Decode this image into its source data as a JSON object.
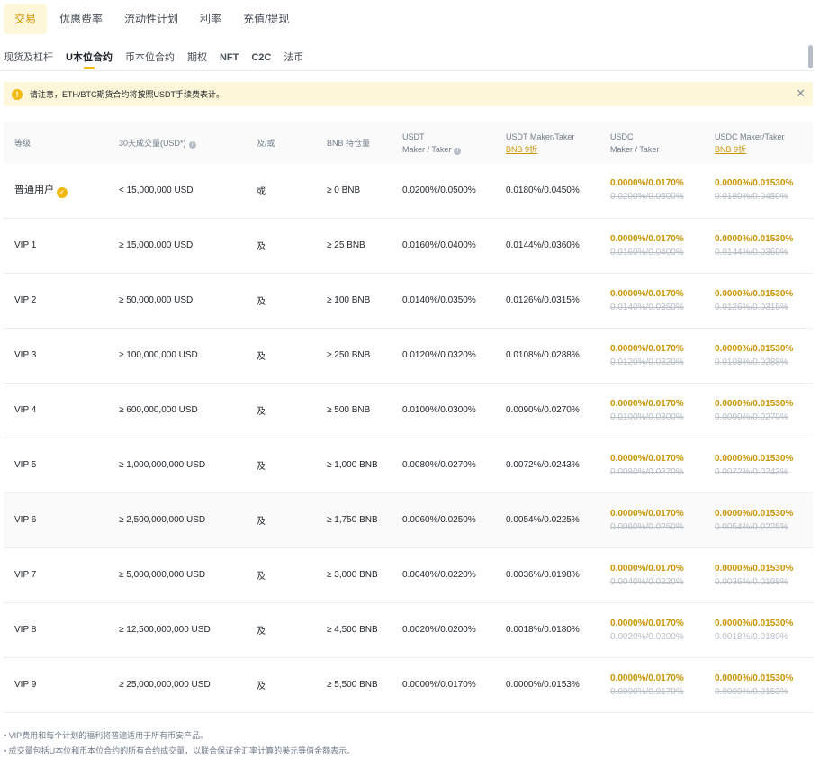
{
  "top_tabs": [
    {
      "label": "交易",
      "active": true
    },
    {
      "label": "优惠费率",
      "active": false
    },
    {
      "label": "流动性计划",
      "active": false
    },
    {
      "label": "利率",
      "active": false
    },
    {
      "label": "充值/提现",
      "active": false
    }
  ],
  "sub_tabs": [
    {
      "label": "现货及杠杆",
      "active": false
    },
    {
      "label": "U本位合约",
      "active": true
    },
    {
      "label": "币本位合约",
      "active": false
    },
    {
      "label": "期权",
      "active": false
    },
    {
      "label": "NFT",
      "active": false
    },
    {
      "label": "C2C",
      "active": false
    },
    {
      "label": "法币",
      "active": false
    }
  ],
  "notice": {
    "text": "请注意，ETH/BTC期货合约将按照USDT手续费表计。",
    "close_icon": "close-icon"
  },
  "table": {
    "headers": {
      "level": "等级",
      "volume": "30天成交量(USD*)",
      "and_or": "及/或",
      "bnb_balance": "BNB 持仓量",
      "usdt_line1": "USDT",
      "usdt_line2": "Maker / Taker",
      "usdt_bnb_line1": "USDT Maker/Taker",
      "usdt_bnb_line2": "BNB 9折",
      "usdc_line1": "USDC",
      "usdc_line2": "Maker / Taker",
      "usdc_bnb_line1": "USDC Maker/Taker",
      "usdc_bnb_line2": "BNB 9折"
    },
    "rows": [
      {
        "level": "普通用户",
        "volume": "< 15,000,000 USD",
        "and_or": "或",
        "bnb": "≥ 0 BNB",
        "usdt": "0.0200%/0.0500%",
        "usdt_bnb": "0.0180%/0.0450%",
        "usdc_promo": "0.0000%/0.0170%",
        "usdc_orig": "0.0200%/0.0500%",
        "usdc_bnb_promo": "0.0000%/0.01530%",
        "usdc_bnb_orig": "0.0180%/0.0450%"
      },
      {
        "level": "VIP 1",
        "volume": "≥ 15,000,000 USD",
        "and_or": "及",
        "bnb": "≥ 25 BNB",
        "usdt": "0.0160%/0.0400%",
        "usdt_bnb": "0.0144%/0.0360%",
        "usdc_promo": "0.0000%/0.0170%",
        "usdc_orig": "0.0160%/0.0400%",
        "usdc_bnb_promo": "0.0000%/0.01530%",
        "usdc_bnb_orig": "0.0144%/0.0360%"
      },
      {
        "level": "VIP 2",
        "volume": "≥ 50,000,000 USD",
        "and_or": "及",
        "bnb": "≥ 100 BNB",
        "usdt": "0.0140%/0.0350%",
        "usdt_bnb": "0.0126%/0.0315%",
        "usdc_promo": "0.0000%/0.0170%",
        "usdc_orig": "0.0140%/0.0350%",
        "usdc_bnb_promo": "0.0000%/0.01530%",
        "usdc_bnb_orig": "0.0126%/0.0315%"
      },
      {
        "level": "VIP 3",
        "volume": "≥ 100,000,000 USD",
        "and_or": "及",
        "bnb": "≥ 250 BNB",
        "usdt": "0.0120%/0.0320%",
        "usdt_bnb": "0.0108%/0.0288%",
        "usdc_promo": "0.0000%/0.0170%",
        "usdc_orig": "0.0120%/0.0320%",
        "usdc_bnb_promo": "0.0000%/0.01530%",
        "usdc_bnb_orig": "0.0108%/0.0288%"
      },
      {
        "level": "VIP 4",
        "volume": "≥ 600,000,000 USD",
        "and_or": "及",
        "bnb": "≥ 500 BNB",
        "usdt": "0.0100%/0.0300%",
        "usdt_bnb": "0.0090%/0.0270%",
        "usdc_promo": "0.0000%/0.0170%",
        "usdc_orig": "0.0100%/0.0300%",
        "usdc_bnb_promo": "0.0000%/0.01530%",
        "usdc_bnb_orig": "0.0090%/0.0270%"
      },
      {
        "level": "VIP 5",
        "volume": "≥ 1,000,000,000 USD",
        "and_or": "及",
        "bnb": "≥ 1,000 BNB",
        "usdt": "0.0080%/0.0270%",
        "usdt_bnb": "0.0072%/0.0243%",
        "usdc_promo": "0.0000%/0.0170%",
        "usdc_orig": "0.0080%/0.0270%",
        "usdc_bnb_promo": "0.0000%/0.01530%",
        "usdc_bnb_orig": "0.0072%/0.0243%"
      },
      {
        "level": "VIP 6",
        "volume": "≥ 2,500,000,000 USD",
        "and_or": "及",
        "bnb": "≥ 1,750 BNB",
        "usdt": "0.0060%/0.0250%",
        "usdt_bnb": "0.0054%/0.0225%",
        "usdc_promo": "0.0000%/0.0170%",
        "usdc_orig": "0.0060%/0.0250%",
        "usdc_bnb_promo": "0.0000%/0.01530%",
        "usdc_bnb_orig": "0.0054%/0.0225%"
      },
      {
        "level": "VIP 7",
        "volume": "≥ 5,000,000,000 USD",
        "and_or": "及",
        "bnb": "≥ 3,000 BNB",
        "usdt": "0.0040%/0.0220%",
        "usdt_bnb": "0.0036%/0.0198%",
        "usdc_promo": "0.0000%/0.0170%",
        "usdc_orig": "0.0040%/0.0220%",
        "usdc_bnb_promo": "0.0000%/0.01530%",
        "usdc_bnb_orig": "0.0036%/0.0198%"
      },
      {
        "level": "VIP 8",
        "volume": "≥ 12,500,000,000 USD",
        "and_or": "及",
        "bnb": "≥ 4,500 BNB",
        "usdt": "0.0020%/0.0200%",
        "usdt_bnb": "0.0018%/0.0180%",
        "usdc_promo": "0.0000%/0.0170%",
        "usdc_orig": "0.0020%/0.0200%",
        "usdc_bnb_promo": "0.0000%/0.01530%",
        "usdc_bnb_orig": "0.0018%/0.0180%"
      },
      {
        "level": "VIP 9",
        "volume": "≥ 25,000,000,000 USD",
        "and_or": "及",
        "bnb": "≥ 5,500 BNB",
        "usdt": "0.0000%/0.0170%",
        "usdt_bnb": "0.0000%/0.0153%",
        "usdc_promo": "0.0000%/0.0170%",
        "usdc_orig": "0.0000%/0.0170%",
        "usdc_bnb_promo": "0.0000%/0.01530%",
        "usdc_bnb_orig": "0.0000%/0.0153%"
      }
    ]
  },
  "footnotes": [
    "VIP费用和每个计划的福利将普遍适用于所有币安产品。",
    "成交量包括U本位和币本位合约的所有合约成交量，以联合保证金汇率计算的美元等值金额表示。"
  ],
  "colors": {
    "accent": "#f0b90b",
    "accent_text": "#c99400",
    "notice_bg": "#fef6d8",
    "strike": "#b7bdc6"
  }
}
